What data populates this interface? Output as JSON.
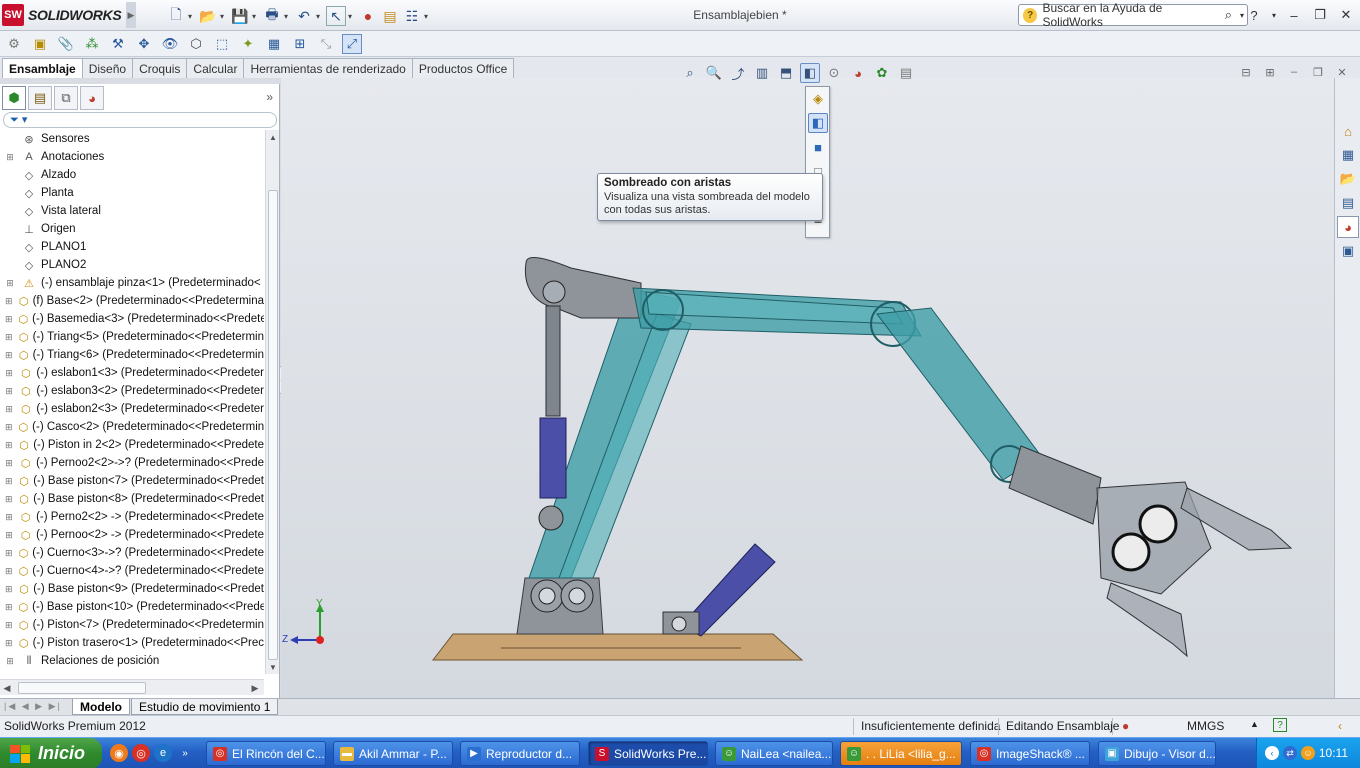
{
  "app": {
    "brand_badge": "SW",
    "brand": "SOLIDWORKS",
    "document_title": "Ensamblajebien *"
  },
  "search": {
    "placeholder": "Buscar en la Ayuda de SolidWorks"
  },
  "command_tabs": [
    {
      "label": "Ensamblaje",
      "active": true
    },
    {
      "label": "Diseño",
      "active": false
    },
    {
      "label": "Croquis",
      "active": false
    },
    {
      "label": "Calcular",
      "active": false
    },
    {
      "label": "Herramientas de renderizado",
      "active": false
    },
    {
      "label": "Productos Office",
      "active": false
    }
  ],
  "tooltip": {
    "title": "Sombreado con aristas",
    "description_line1": "Visualiza una vista sombreada del modelo",
    "description_line2": "con todas sus aristas."
  },
  "tree": [
    {
      "label": "Sensores",
      "icon": "sensor-icon",
      "expandable": false
    },
    {
      "label": "Anotaciones",
      "icon": "annotation-icon",
      "expandable": true
    },
    {
      "label": "Alzado",
      "icon": "plane-icon",
      "expandable": false
    },
    {
      "label": "Planta",
      "icon": "plane-icon",
      "expandable": false
    },
    {
      "label": "Vista lateral",
      "icon": "plane-icon",
      "expandable": false
    },
    {
      "label": "Origen",
      "icon": "origin-icon",
      "expandable": false
    },
    {
      "label": "PLANO1",
      "icon": "plane-icon",
      "expandable": false
    },
    {
      "label": "PLANO2",
      "icon": "plane-icon",
      "expandable": false
    },
    {
      "label": "(-) ensamblaje pinza<1> (Predeterminado<",
      "icon": "subassembly-warning-icon",
      "expandable": true
    },
    {
      "label": "(f) Base<2> (Predeterminado<<Predetermina",
      "icon": "part-icon",
      "expandable": true
    },
    {
      "label": "(-) Basemedia<3> (Predeterminado<<Predete",
      "icon": "part-icon",
      "expandable": true
    },
    {
      "label": "(-) Triang<5> (Predeterminado<<Predetermin",
      "icon": "part-icon",
      "expandable": true
    },
    {
      "label": "(-) Triang<6> (Predeterminado<<Predetermin",
      "icon": "part-icon",
      "expandable": true
    },
    {
      "label": "(-) eslabon1<3> (Predeterminado<<Predeter",
      "icon": "part-icon",
      "expandable": true
    },
    {
      "label": "(-) eslabon3<2> (Predeterminado<<Predeter",
      "icon": "part-icon",
      "expandable": true
    },
    {
      "label": "(-) eslabon2<3> (Predeterminado<<Predeter",
      "icon": "part-icon",
      "expandable": true
    },
    {
      "label": "(-) Casco<2> (Predeterminado<<Predetermin",
      "icon": "part-icon",
      "expandable": true
    },
    {
      "label": "(-) Piston in 2<2> (Predeterminado<<Predete",
      "icon": "part-icon",
      "expandable": true
    },
    {
      "label": "(-) Pernoo2<2>->? (Predeterminado<<Prede",
      "icon": "part-icon",
      "expandable": true
    },
    {
      "label": "(-) Base piston<7> (Predeterminado<<Predet",
      "icon": "part-icon",
      "expandable": true
    },
    {
      "label": "(-) Base piston<8> (Predeterminado<<Predet",
      "icon": "part-icon",
      "expandable": true
    },
    {
      "label": "(-) Perno2<2> -> (Predeterminado<<Predete",
      "icon": "part-icon",
      "expandable": true
    },
    {
      "label": "(-) Pernoo<2> -> (Predeterminado<<Predete",
      "icon": "part-icon",
      "expandable": true
    },
    {
      "label": "(-) Cuerno<3>->? (Predeterminado<<Predete",
      "icon": "part-icon",
      "expandable": true
    },
    {
      "label": "(-) Cuerno<4>->? (Predeterminado<<Predete",
      "icon": "part-icon",
      "expandable": true
    },
    {
      "label": "(-) Base piston<9> (Predeterminado<<Predet",
      "icon": "part-icon",
      "expandable": true
    },
    {
      "label": "(-) Base piston<10> (Predeterminado<<Prede",
      "icon": "part-icon",
      "expandable": true
    },
    {
      "label": "(-) Piston<7> (Predeterminado<<Predetermin",
      "icon": "part-icon",
      "expandable": true
    },
    {
      "label": "(-) Piston trasero<1> (Predeterminado<<Prec",
      "icon": "part-icon",
      "expandable": true
    },
    {
      "label": "Relaciones de posición",
      "icon": "mates-icon",
      "expandable": true
    }
  ],
  "triad": {
    "y_label": "Y",
    "z_label": "Z"
  },
  "bottom_tabs": [
    {
      "label": "Modelo",
      "active": true
    },
    {
      "label": "Estudio de movimiento 1",
      "active": false
    }
  ],
  "status": {
    "product": "SolidWorks Premium 2012",
    "definition": "Insuficientemente definida",
    "mode": "Editando Ensamblaje",
    "units": "MMGS"
  },
  "taskbar": {
    "start_label": "Inicio",
    "clock": "10:11",
    "items": [
      {
        "label": "El Rincón del C...",
        "icon": "chrome-icon",
        "active": false,
        "alert": false
      },
      {
        "label": "Akil Ammar - P...",
        "icon": "folder-icon",
        "active": false,
        "alert": false
      },
      {
        "label": "Reproductor d...",
        "icon": "media-player-icon",
        "active": false,
        "alert": false
      },
      {
        "label": "SolidWorks Pre...",
        "icon": "solidworks-icon",
        "active": true,
        "alert": false
      },
      {
        "label": "NaiLea <nailea...",
        "icon": "messenger-icon",
        "active": false,
        "alert": false
      },
      {
        "label": ". . LiLia <lilia_g...",
        "icon": "messenger-icon",
        "active": false,
        "alert": true
      },
      {
        "label": "ImageShack® ...",
        "icon": "chrome-icon",
        "active": false,
        "alert": false
      },
      {
        "label": "Dibujo - Visor d...",
        "icon": "viewer-icon",
        "active": false,
        "alert": false
      }
    ]
  },
  "colors": {
    "arm_teal": "#3e9da6",
    "arm_teal_dark": "#1f5e66",
    "piston_purple": "#4b4fa8",
    "base_wood": "#c9a472",
    "gray_part": "#8f939a"
  }
}
